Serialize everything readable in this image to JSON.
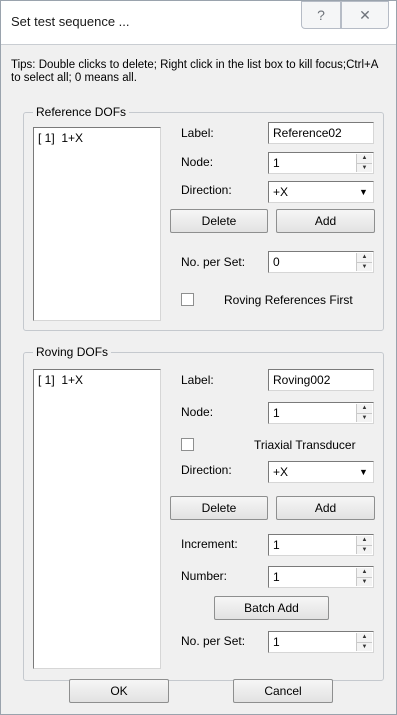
{
  "window": {
    "title": "Set test sequence ...",
    "help_glyph": "?",
    "close_glyph": "✕"
  },
  "tips": "Tips: Double clicks to delete; Right click in the list box to kill focus;Ctrl+A to select all; 0 means all.",
  "reference": {
    "group_title": "Reference DOFs",
    "list_items": [
      "[ 1]  1+X"
    ],
    "label_caption": "Label:",
    "label_value": "Reference02",
    "node_caption": "Node:",
    "node_value": "1",
    "direction_caption": "Direction:",
    "direction_value": "+X",
    "delete_label": "Delete",
    "add_label": "Add",
    "per_set_caption": "No. per Set:",
    "per_set_value": "0",
    "roving_first_label": "Roving References First",
    "roving_first_checked": false
  },
  "roving": {
    "group_title": "Roving DOFs",
    "list_items": [
      "[ 1]  1+X"
    ],
    "label_caption": "Label:",
    "label_value": "Roving002",
    "node_caption": "Node:",
    "node_value": "1",
    "triaxial_label": "Triaxial Transducer",
    "triaxial_checked": false,
    "direction_caption": "Direction:",
    "direction_value": "+X",
    "delete_label": "Delete",
    "add_label": "Add",
    "increment_caption": "Increment:",
    "increment_value": "1",
    "number_caption": "Number:",
    "number_value": "1",
    "batch_add_label": "Batch Add",
    "per_set_caption": "No. per Set:",
    "per_set_value": "1"
  },
  "footer": {
    "ok_label": "OK",
    "cancel_label": "Cancel"
  }
}
